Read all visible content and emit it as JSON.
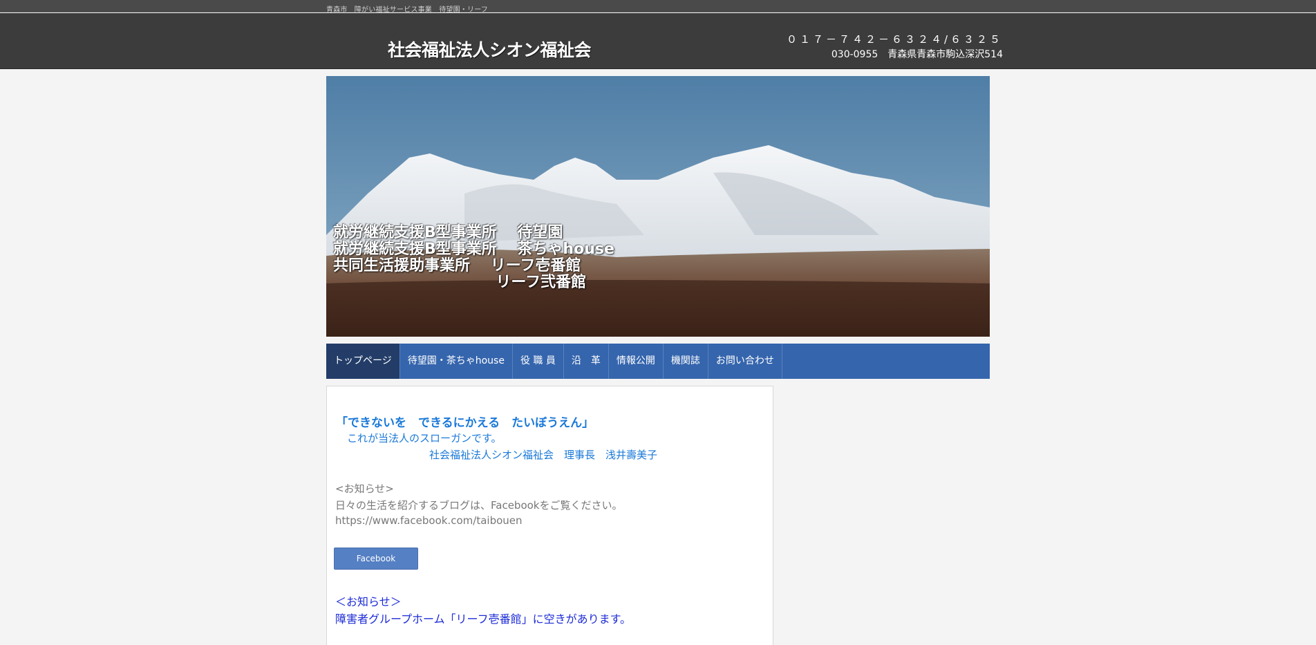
{
  "topbar": {
    "tagline": "青森市　障がい福祉サービス事業　待望園・リーフ"
  },
  "header": {
    "site_title": "社会福祉法人シオン福祉会",
    "phone": "０１７－７４２－６３２４/６３２５",
    "address": "030-0955　青森県青森市駒込深沢514"
  },
  "hero": {
    "lines": [
      "就労継続支援B型事業所　 待望園",
      "就労継続支援B型事業所　 茶ちゃhouse",
      "共同生活援助事業所　 リーフ壱番館",
      "　　　　　　　　　　  リーフ弐番館"
    ]
  },
  "nav": {
    "items": [
      {
        "label": "トップページ",
        "active": true
      },
      {
        "label": "待望園・茶ちゃhouse",
        "active": false
      },
      {
        "label": "役 職 員",
        "active": false
      },
      {
        "label": "沿　革",
        "active": false
      },
      {
        "label": "情報公開",
        "active": false
      },
      {
        "label": "機関誌",
        "active": false
      },
      {
        "label": "お問い合わせ",
        "active": false
      }
    ]
  },
  "main": {
    "slogan": "「できないを　できるにかえる　たいぼうえん」",
    "slogan_sub": "これが当法人のスローガンです。",
    "signature": "社会福祉法人シオン福祉会　理事長　浅井壽美子",
    "notice1": {
      "label": "<お知らせ>",
      "text": "日々の生活を紹介するブログは、Facebookをご覧ください。",
      "url": "https://www.facebook.com/taibouen"
    },
    "facebook_button": "Facebook",
    "notice2": {
      "label": "＜お知らせ＞",
      "text": "障害者グループホーム「リーフ壱番館」に空きがあります。"
    }
  },
  "colors": {
    "header_bg": "#3c3c3c",
    "nav_bg": "#3565ad",
    "nav_active": "#233d68",
    "slogan": "#1a79d8",
    "notice2": "#1d2bd6"
  }
}
